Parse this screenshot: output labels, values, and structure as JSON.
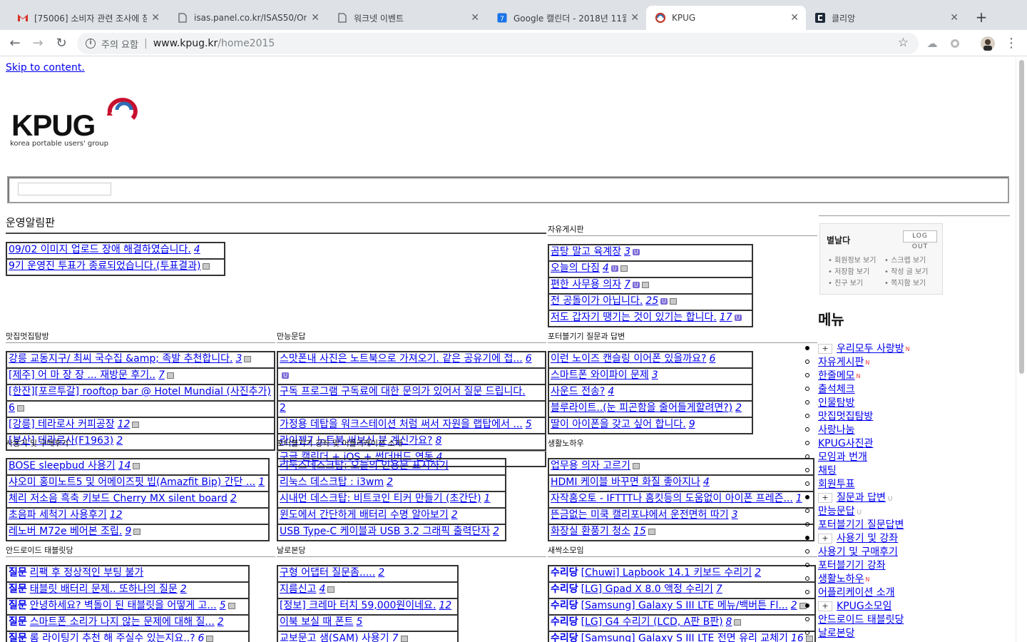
{
  "tabs": [
    {
      "title": "[75006] 소비자 관련 조사에 참여",
      "icon": "gmail-icon"
    },
    {
      "title": "isas.panel.co.kr/ISAS50/On/",
      "icon": "page-icon"
    },
    {
      "title": "워크넷 이벤트",
      "icon": "page-icon"
    },
    {
      "title": "Google 캘린더 - 2018년 11월",
      "icon": "calendar-icon"
    },
    {
      "title": "KPUG",
      "icon": "kpug-icon"
    },
    {
      "title": "클리앙",
      "icon": "clien-icon"
    }
  ],
  "toolbar": {
    "security_label": "주의 요함",
    "url_host": "www.kpug.kr",
    "url_path": "/home2015"
  },
  "page": {
    "skip_link": "Skip to content.",
    "logo_text": "KPUG",
    "logo_tagline": "korea portable users' group"
  },
  "boards": {
    "notice": {
      "title": "운영알림판",
      "rows": [
        {
          "text": "09/02 이미지 업로드 장애 해결하였습니다.",
          "count": "4",
          "icons": []
        },
        {
          "text": "9기 운영진 투표가 종료되었습니다.(투표결과)",
          "count": "",
          "icons": [
            "img"
          ]
        }
      ]
    },
    "free": {
      "title": "자유게시판",
      "rows": [
        {
          "text": "곰탕 말고 육계장",
          "count": "3",
          "icons": [
            "u"
          ]
        },
        {
          "text": "오늘의 다짐",
          "count": "4",
          "icons": [
            "u",
            "img"
          ]
        },
        {
          "text": "편한 사무용 의자",
          "count": "7",
          "icons": [
            "u",
            "img"
          ]
        },
        {
          "text": "전 공돌이가 아닙니다.",
          "count": "25",
          "icons": [
            "u",
            "img"
          ]
        },
        {
          "text": "저도 갑자기 땡기는 것이 있기는 합니다.",
          "count": "17",
          "icons": [
            "u"
          ]
        }
      ]
    },
    "food": {
      "title": "맛집멋집탐방",
      "rows": [
        {
          "text": "강릉 교동지구/ 최씨 국수집 &amp; 족발 추천합니다.",
          "count": "3",
          "icons": [
            "img"
          ]
        },
        {
          "text": "[제주] 어 마 장 장 ... 재방문 후기..",
          "count": "7",
          "icons": [
            "img"
          ]
        },
        {
          "text": "[한잔][포르투갈] rooftop bar @ Hotel Mundial (사진추가)",
          "count": "",
          "icons": []
        },
        {
          "text": "6",
          "count": "",
          "icons": [
            "img"
          ]
        },
        {
          "text": "[강릉] 테라로사 커피공장",
          "count": "12",
          "icons": [
            "img"
          ]
        },
        {
          "text": "[부산] 테라로사(F1963)",
          "count": "2",
          "icons": []
        }
      ]
    },
    "qna": {
      "title": "만능문답",
      "rows": [
        {
          "text": "스맛폰내 사진은 노트북으로 가져오기. 같은 공유기에 접...",
          "count": "6",
          "icons": []
        },
        {
          "text": "",
          "count": "",
          "icons": [
            "u"
          ]
        },
        {
          "text": "구독 프로그램 구독료에 대한 문의가 있어서 질문 드립니다.",
          "count": "",
          "icons": []
        },
        {
          "text": "2",
          "count": "",
          "icons": []
        },
        {
          "text": "가정용 데탑을 워크스테이션 처럼 써서 자원을 랩탑에서 ...",
          "count": "5",
          "icons": []
        },
        {
          "text": "라이젠7 노트북 써보신 분 계신가요?",
          "count": "8",
          "icons": []
        },
        {
          "text": "구글 캘린더 + iOS + 썬더버드 연동",
          "count": "4",
          "icons": []
        }
      ]
    },
    "portable_qna": {
      "title": "포터블기기 질문과 답변",
      "rows": [
        {
          "text": "이런 노이즈 캔슬링 이어폰 있을까요?",
          "count": "6",
          "icons": []
        },
        {
          "text": "스마트폰 와이파이 문제",
          "count": "3",
          "icons": []
        },
        {
          "text": "사운드 전송?",
          "count": "4",
          "icons": []
        },
        {
          "text": "블루라이트..(눈 피곤함을 줄어들게할려면?)",
          "count": "2",
          "icons": []
        },
        {
          "text": "딸이 아이폰을 갖고 싶어 합니다.",
          "count": "9",
          "icons": []
        }
      ]
    },
    "review": {
      "title": "사용기 및 구매후기",
      "rows": [
        {
          "text": "BOSE sleepbud 사용기",
          "count": "14",
          "icons": [
            "img"
          ]
        },
        {
          "text": "샤오미 홍미노트5 및 어메이즈핏 빕(Amazfit Bip) 간단 ...",
          "count": "1",
          "icons": []
        },
        {
          "text": "체리 저소음 흑축 키보드 Cherry MX silent board",
          "count": "2",
          "icons": []
        },
        {
          "text": "초음파 세척기 사용후기",
          "count": "12",
          "icons": []
        },
        {
          "text": "레노버 M72e 베어본 조립.",
          "count": "9",
          "icons": [
            "img"
          ]
        }
      ]
    },
    "lecture": {
      "title": "포터블기기 강좌 및 어플리케이션 소개",
      "rows": [
        {
          "text": "리눅스데스크탑: 오늘의 인용문 표시하기",
          "count": "",
          "icons": []
        },
        {
          "text": "리눅스 데스크탑 : i3wm",
          "count": "2",
          "icons": []
        },
        {
          "text": "시내먼 데스크탑: 비트코인 티커 만들기 (초간단)",
          "count": "1",
          "icons": []
        },
        {
          "text": "윈도에서 간단하게 배터리 수명 알아보기",
          "count": "2",
          "icons": []
        },
        {
          "text": "USB Type-C 케이블과 USB 3.2 그래픽 출력단자",
          "count": "2",
          "icons": []
        }
      ]
    },
    "life": {
      "title": "생활노하우",
      "rows": [
        {
          "text": "업무용 의자 고르기",
          "count": "",
          "icons": [
            "img"
          ]
        },
        {
          "text": "HDMI 케이블 바꾸면 화질 좋아지나",
          "count": "4",
          "icons": []
        },
        {
          "text": "자작홈오토 - IFTTT나 홈킷등의 도움없이 아이폰 프레즌...",
          "count": "1",
          "icons": []
        },
        {
          "text": "뜬금없는 미쿡 캘리포냐에서 운전면허 따기",
          "count": "3",
          "icons": []
        },
        {
          "text": "화장실 환풍기 청소",
          "count": "15",
          "icons": [
            "img"
          ]
        }
      ]
    },
    "android": {
      "title": "안드로이드 태블릿당",
      "rows": [
        {
          "cat": "질문",
          "text": "리팩 후 정상적인 부팅 불가",
          "count": "",
          "icons": []
        },
        {
          "cat": "질문",
          "text": "태블릿 배터리 문제.. 또하나의 질문",
          "count": "2",
          "icons": []
        },
        {
          "cat": "질문",
          "text": "안녕하세요? 벽돌이 된 태블릿을 어떻게 고...",
          "count": "5",
          "icons": [
            "img"
          ]
        },
        {
          "cat": "질문",
          "text": "스마트폰 소리가 나지 않는 문제에 대해 질...",
          "count": "2",
          "icons": []
        },
        {
          "cat": "질문",
          "text": "롬 라이팅기 추천 해 주실수 있는지요..?",
          "count": "6",
          "icons": [
            "img"
          ]
        }
      ]
    },
    "nalo": {
      "title": "날로본당",
      "rows": [
        {
          "text": "구형 어댑터 질문좀.....",
          "count": "2",
          "icons": []
        },
        {
          "text": "지름신고",
          "count": "4",
          "icons": [
            "img"
          ]
        },
        {
          "text": "[정보] 크레마 터치 59,000원이네요.",
          "count": "12",
          "icons": []
        },
        {
          "text": "이북 보실 때 폰트",
          "count": "5",
          "icons": []
        },
        {
          "text": "교보문고 샘(SAM) 사용기",
          "count": "7",
          "icons": [
            "img"
          ]
        }
      ]
    },
    "sprout": {
      "title": "새싹소모임",
      "rows": [
        {
          "cat": "수리당",
          "text": "[Chuwi] Lapbook 14.1 키보드 수리기",
          "count": "2",
          "icons": []
        },
        {
          "cat": "수리당",
          "text": "[LG] Gpad X 8.0 액정 수리기",
          "count": "7",
          "icons": []
        },
        {
          "cat": "수리당",
          "text": "[Samsung] Galaxy S III LTE 메뉴/백버튼 Fl...",
          "count": "2",
          "icons": [
            "img"
          ]
        },
        {
          "cat": "수리당",
          "text": "[LG] G4 수리기 (LCD, A판 B판)",
          "count": "8",
          "icons": [
            "img"
          ]
        },
        {
          "cat": "수리당",
          "text": "[Samsung] Galaxy S III LTE 전면 유리 교체기",
          "count": "16",
          "icons": [
            "img"
          ]
        }
      ]
    }
  },
  "login": {
    "nickname": "별날다",
    "logout": "LOG OUT",
    "links": [
      "회원정보 보기",
      "스크랩 보기",
      "저장함 보기",
      "작성 글 보기",
      "친구 보기",
      "쪽지함 보기"
    ]
  },
  "menu": {
    "title": "메뉴",
    "items": [
      {
        "label": "우리모두 사랑방",
        "plus": true,
        "bullet": "filled",
        "badge": "N"
      },
      {
        "label": "자유게시판",
        "plus": false,
        "bullet": "open",
        "badge": "N"
      },
      {
        "label": "한줄메모",
        "plus": false,
        "bullet": "open",
        "badge": "N"
      },
      {
        "label": "출석체크",
        "plus": false,
        "bullet": "open",
        "badge": ""
      },
      {
        "label": "인물탐방",
        "plus": false,
        "bullet": "open",
        "badge": ""
      },
      {
        "label": "맛집멋집탐방",
        "plus": false,
        "bullet": "open",
        "badge": ""
      },
      {
        "label": "사랑나눔",
        "plus": false,
        "bullet": "open",
        "badge": ""
      },
      {
        "label": "KPUG사진관",
        "plus": false,
        "bullet": "open",
        "badge": ""
      },
      {
        "label": "모임과 번개",
        "plus": false,
        "bullet": "open",
        "badge": ""
      },
      {
        "label": "채팅",
        "plus": false,
        "bullet": "open",
        "badge": ""
      },
      {
        "label": "회원투표",
        "plus": false,
        "bullet": "open",
        "badge": ""
      },
      {
        "label": "질문과 답변",
        "plus": true,
        "bullet": "filled",
        "badge": "U"
      },
      {
        "label": "만능문답",
        "plus": false,
        "bullet": "open",
        "badge": "U"
      },
      {
        "label": "포터블기기 질문답변",
        "plus": false,
        "bullet": "open",
        "badge": ""
      },
      {
        "label": "사용기 및 강좌",
        "plus": true,
        "bullet": "filled",
        "badge": ""
      },
      {
        "label": "사용기 및 구매후기",
        "plus": false,
        "bullet": "open",
        "badge": ""
      },
      {
        "label": "포터블기기 강좌",
        "plus": false,
        "bullet": "open",
        "badge": ""
      },
      {
        "label": "생활노하우",
        "plus": false,
        "bullet": "open",
        "badge": "N"
      },
      {
        "label": "어플리케이션 소개",
        "plus": false,
        "bullet": "open",
        "badge": ""
      },
      {
        "label": "KPUG소모임",
        "plus": true,
        "bullet": "filled",
        "badge": ""
      },
      {
        "label": "안드로이드 태블릿당",
        "plus": false,
        "bullet": "open",
        "badge": ""
      },
      {
        "label": "날로본당",
        "plus": false,
        "bullet": "open",
        "badge": ""
      }
    ]
  }
}
